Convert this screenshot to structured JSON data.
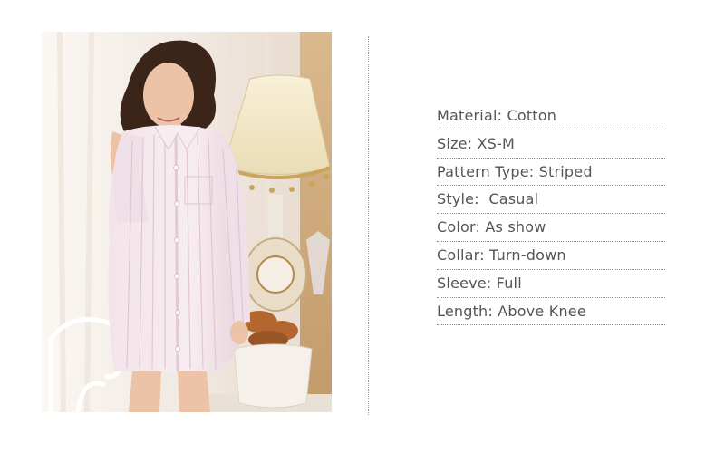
{
  "product_image": {
    "alt": "Woman wearing a striped button-down nightshirt"
  },
  "specs": [
    "Material: Cotton",
    "Size: XS-M",
    "Pattern Type: Striped",
    "Style:  Casual",
    "Color: As show",
    "Collar: Turn-down",
    "Sleeve: Full",
    "Length: Above Knee"
  ]
}
